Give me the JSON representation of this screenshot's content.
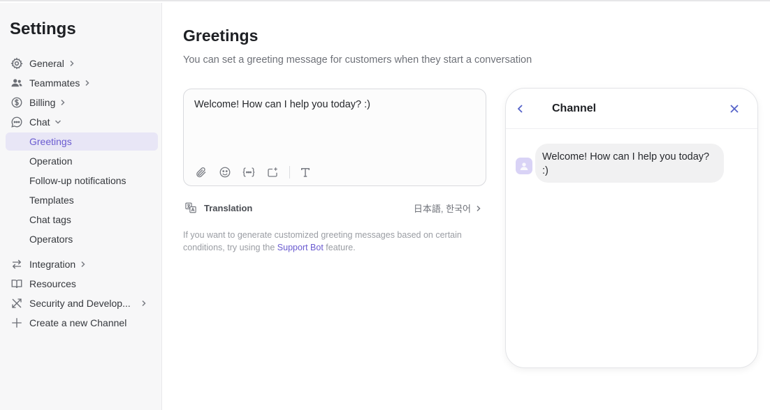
{
  "sidebar": {
    "title": "Settings",
    "items": [
      {
        "label": "General",
        "icon": "gear-icon"
      },
      {
        "label": "Teammates",
        "icon": "people-icon"
      },
      {
        "label": "Billing",
        "icon": "dollar-icon"
      },
      {
        "label": "Chat",
        "icon": "chat-icon"
      },
      {
        "label": "Integration",
        "icon": "arrows-icon"
      },
      {
        "label": "Resources",
        "icon": "book-icon"
      },
      {
        "label": "Security and Develop...",
        "icon": "tools-icon"
      },
      {
        "label": "Create a new Channel",
        "icon": "plus-icon"
      }
    ],
    "chat_subitems": [
      {
        "label": "Greetings",
        "active": true
      },
      {
        "label": "Operation"
      },
      {
        "label": "Follow-up notifications"
      },
      {
        "label": "Templates"
      },
      {
        "label": "Chat tags"
      },
      {
        "label": "Operators"
      }
    ]
  },
  "main": {
    "title": "Greetings",
    "subtitle": "You can set a greeting message for customers when they start a conversation",
    "editor": {
      "text": "Welcome! How can I help you today? :)",
      "toolbar": [
        "attach-icon",
        "emoji-icon",
        "variable-icon",
        "button-icon",
        "text-format-icon"
      ]
    },
    "translation": {
      "label": "Translation",
      "languages": "日本語, 한국어"
    },
    "hint": {
      "before": "If you want to generate customized greeting messages based on certain conditions, try using the ",
      "link": "Support Bot",
      "after": " feature."
    }
  },
  "preview": {
    "title": "Channel",
    "message": "Welcome! How can I help you today? :)"
  },
  "colors": {
    "accent": "#6a5bd0",
    "active_bg": "#e8e6f6",
    "sidebar_bg": "#f7f7f8",
    "preview_icon": "#5563c9"
  }
}
